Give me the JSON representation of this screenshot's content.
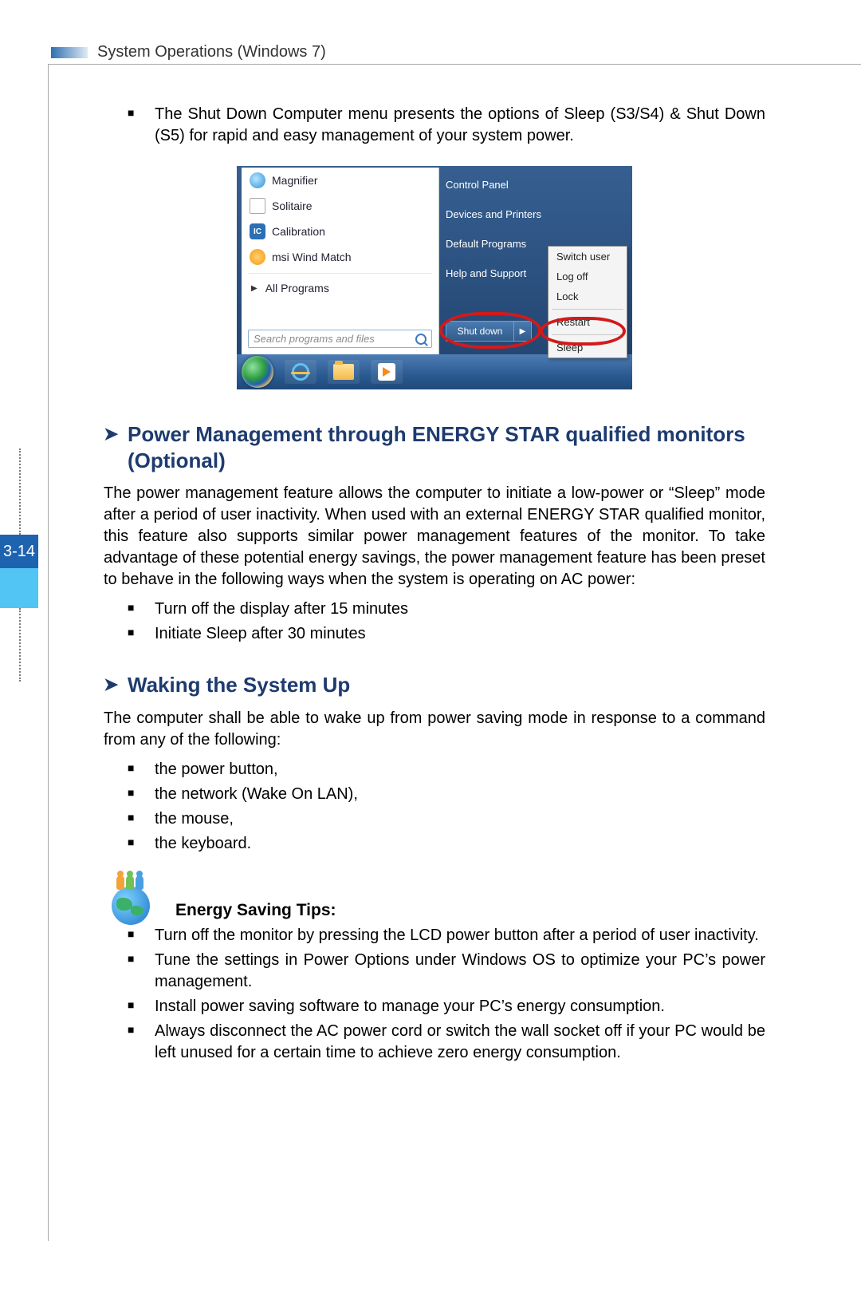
{
  "header": {
    "title": "System Operations (Windows 7)"
  },
  "page_number": "3-14",
  "intro_bullet": "The Shut Down Computer menu presents the options of Sleep (S3/S4) & Shut Down (S5) for rapid and easy management of your system power.",
  "screenshot": {
    "programs": [
      {
        "label": "Magnifier"
      },
      {
        "label": "Solitaire"
      },
      {
        "label": "Calibration"
      },
      {
        "label": "msi Wind Match"
      }
    ],
    "all_programs": "All Programs",
    "search_placeholder": "Search programs and files",
    "right_links": [
      "Control Panel",
      "Devices and Printers",
      "Default Programs",
      "Help and Support"
    ],
    "shutdown_label": "Shut down",
    "power_menu": [
      "Switch user",
      "Log off",
      "Lock",
      "Restart",
      "Sleep"
    ]
  },
  "section1": {
    "heading": "Power Management through ENERGY STAR qualified monitors (Optional)",
    "para": "The power management feature allows the computer to initiate a low-power or “Sleep” mode after a period of user inactivity. When used with an external ENERGY STAR qualified monitor, this feature also supports similar power management features of the monitor. To take advantage of these potential energy savings, the power management feature has been preset to behave in the following ways when the system is operating on AC power:",
    "bullets": [
      "Turn off the display after 15 minutes",
      "Initiate Sleep after 30 minutes"
    ]
  },
  "section2": {
    "heading": "Waking the System Up",
    "para": "The computer shall be able to wake up from power saving mode in response to a command from any of the following:",
    "bullets": [
      "the power button,",
      "the network (Wake On LAN),",
      "the mouse,",
      "the keyboard."
    ]
  },
  "energy": {
    "title": "Energy Saving Tips:",
    "bullets": [
      "Turn off the monitor by pressing the LCD power button after a period of user inactivity.",
      "Tune the settings in Power Options under Windows OS to optimize your PC’s power management.",
      "Install power saving software to manage your PC’s energy consumption.",
      "Always disconnect the AC power cord or switch the wall socket off if your PC would be left unused for a certain time to achieve zero energy consumption."
    ]
  }
}
